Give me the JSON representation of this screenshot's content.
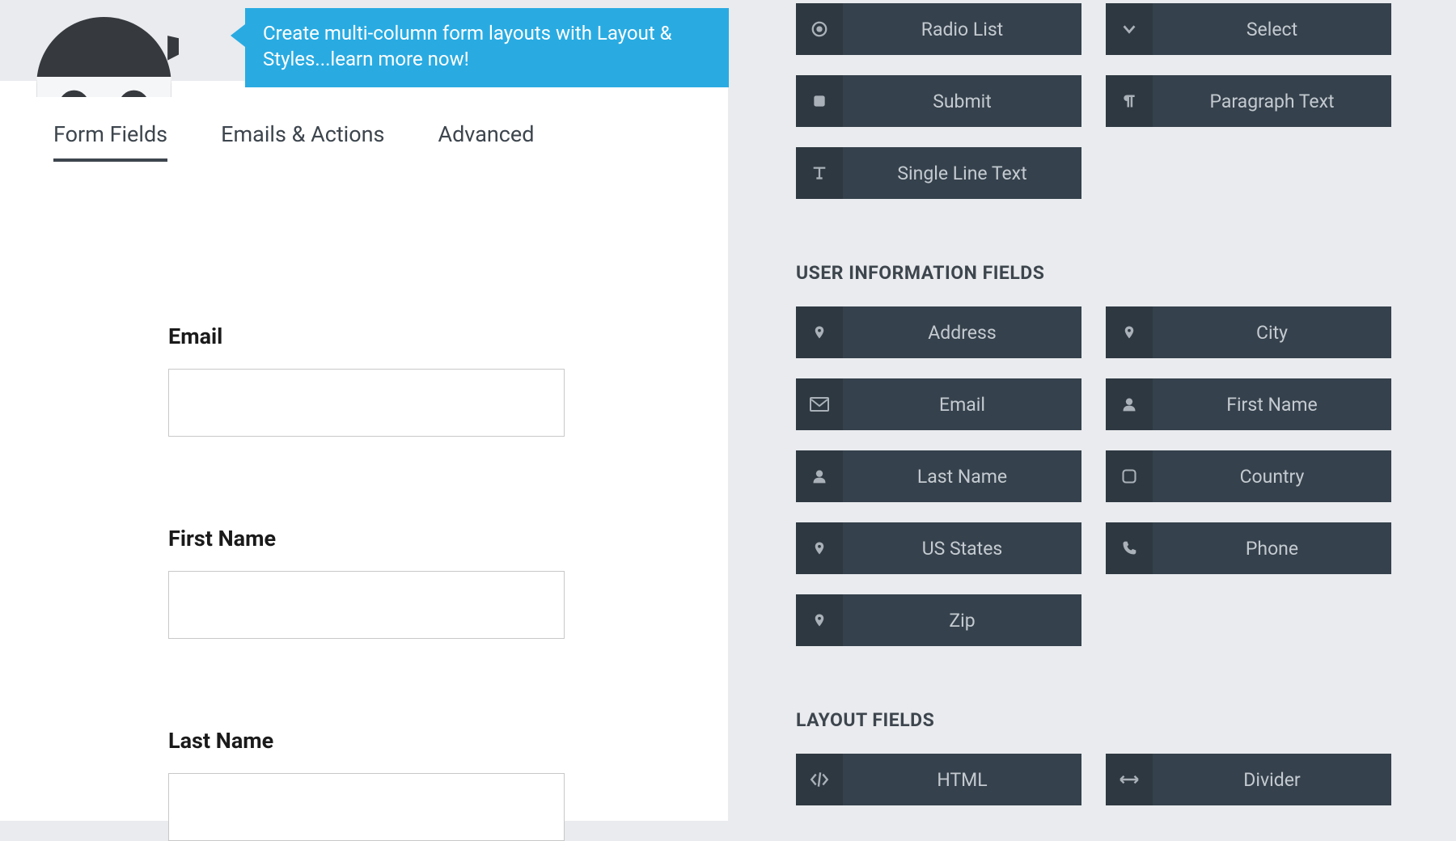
{
  "tooltip": "Create multi-column form layouts with Layout & Styles...learn more now!",
  "tabs": [
    {
      "label": "Form Fields",
      "active": true
    },
    {
      "label": "Emails & Actions",
      "active": false
    },
    {
      "label": "Advanced",
      "active": false
    }
  ],
  "form_fields": [
    {
      "label": "Email",
      "value": ""
    },
    {
      "label": "First Name",
      "value": ""
    },
    {
      "label": "Last Name",
      "value": ""
    }
  ],
  "sections": {
    "common_fields": {
      "items": [
        {
          "icon": "radio",
          "label": "Radio List"
        },
        {
          "icon": "chevron-down",
          "label": "Select"
        },
        {
          "icon": "square",
          "label": "Submit"
        },
        {
          "icon": "paragraph",
          "label": "Paragraph Text"
        },
        {
          "icon": "text-cursor",
          "label": "Single Line Text"
        }
      ]
    },
    "user_info": {
      "title": "USER INFORMATION FIELDS",
      "items": [
        {
          "icon": "map-marker",
          "label": "Address"
        },
        {
          "icon": "map-marker",
          "label": "City"
        },
        {
          "icon": "envelope",
          "label": "Email"
        },
        {
          "icon": "user",
          "label": "First Name"
        },
        {
          "icon": "user",
          "label": "Last Name"
        },
        {
          "icon": "square-outline",
          "label": "Country"
        },
        {
          "icon": "map-marker",
          "label": "US States"
        },
        {
          "icon": "phone",
          "label": "Phone"
        },
        {
          "icon": "map-marker",
          "label": "Zip"
        }
      ]
    },
    "layout": {
      "title": "LAYOUT FIELDS",
      "items": [
        {
          "icon": "code",
          "label": "HTML"
        },
        {
          "icon": "arrows-h",
          "label": "Divider"
        }
      ]
    }
  }
}
